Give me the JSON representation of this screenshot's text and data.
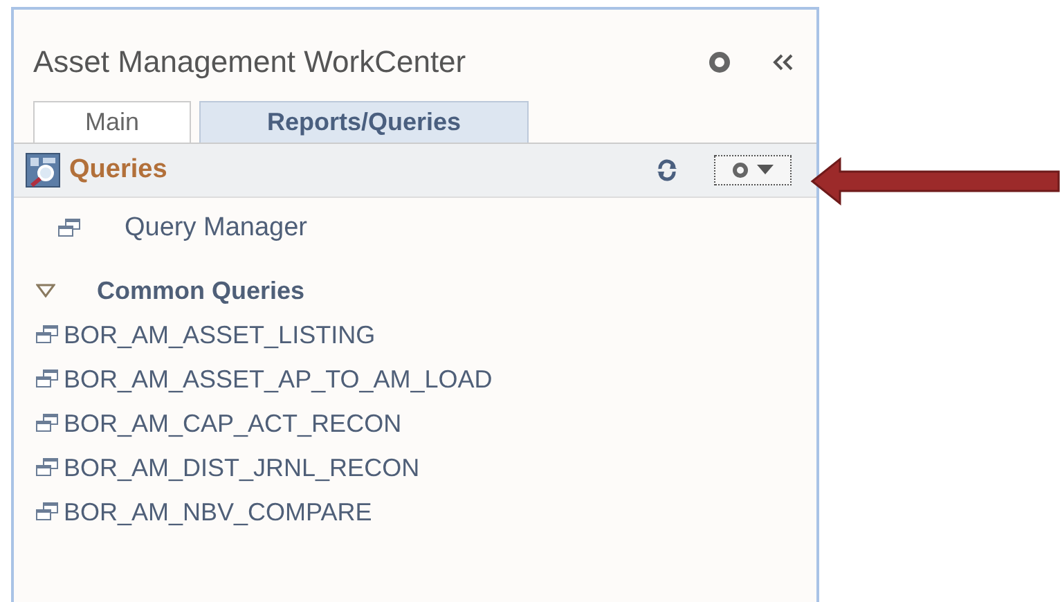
{
  "panel": {
    "title": "Asset Management WorkCenter"
  },
  "tabs": [
    {
      "label": "Main",
      "selected": false
    },
    {
      "label": "Reports/Queries",
      "selected": true
    }
  ],
  "section": {
    "title": "Queries"
  },
  "links": [
    {
      "label": "Query Manager"
    }
  ],
  "group": {
    "label": "Common Queries",
    "expanded": true,
    "items": [
      {
        "label": "BOR_AM_ASSET_LISTING"
      },
      {
        "label": "BOR_AM_ASSET_AP_TO_AM_LOAD"
      },
      {
        "label": "BOR_AM_CAP_ACT_RECON"
      },
      {
        "label": "BOR_AM_DIST_JRNL_RECON"
      },
      {
        "label": "BOR_AM_NBV_COMPARE"
      }
    ]
  }
}
